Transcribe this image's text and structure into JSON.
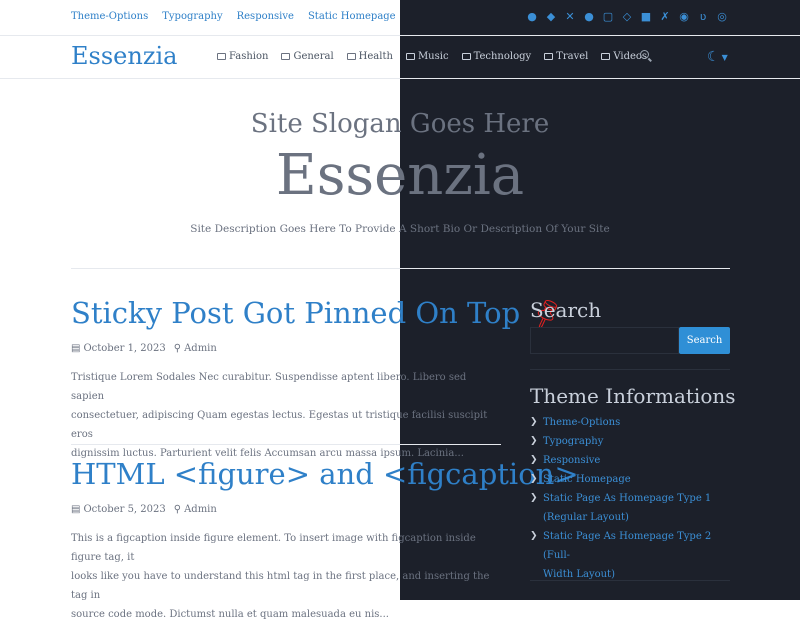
{
  "topbar": {
    "links": [
      "Theme-Options",
      "Typography",
      "Responsive",
      "Static Homepage"
    ],
    "socials": [
      "github-icon",
      "gitlab-icon",
      "x-icon",
      "facebook-icon",
      "instagram-icon",
      "codepen-icon",
      "linkedin-icon",
      "xing-icon",
      "mastodon-icon",
      "vk-icon",
      "dribbble-icon"
    ]
  },
  "header": {
    "logo": "Essenzia",
    "nav": [
      "Fashion",
      "General",
      "Health",
      "Music",
      "Technology",
      "Travel",
      "Videos"
    ]
  },
  "hero": {
    "slogan": "Site Slogan Goes Here",
    "title": "Essenzia",
    "description": "Site Description Goes Here To Provide A Short Bio Or Description Of Your Site"
  },
  "posts": [
    {
      "title": "Sticky Post Got Pinned On Top",
      "date": "October 1, 2023",
      "author": "Admin",
      "excerpt": [
        "Tristique Lorem Sodales Nec curabitur. Suspendisse aptent libero. Libero sed sapien",
        "consectetuer, adipiscing Quam egestas lectus. Egestas ut tristique facilisi suscipit eros",
        "dignissim luctus. Parturient velit felis Accumsan arcu massa ipsum. Lacinia..."
      ]
    },
    {
      "title": "HTML <figure> and <figcaption>",
      "date": "October 5, 2023",
      "author": "Admin",
      "excerpt": [
        "This is a figcaption inside figure element. To insert image with figcaption inside figure tag, it",
        "looks like you have to understand this html tag in the first place, and inserting the tag in",
        "source code mode. Dictumst nulla et quam malesuada eu nis..."
      ]
    }
  ],
  "sidebar": {
    "search_heading": "Search",
    "search_button": "Search",
    "theme_heading": "Theme Informations",
    "theme_items": [
      "Theme-Options",
      "Typography",
      "Responsive",
      "Static Homepage",
      "Static Page As Homepage Type 1",
      "(Regular Layout)",
      "Static Page As Homepage Type 2 (Full-",
      "Width Layout)"
    ]
  },
  "colors": {
    "accent": "#2f80c8",
    "dark_bg": "#1c202a",
    "pin": "#e02020"
  }
}
